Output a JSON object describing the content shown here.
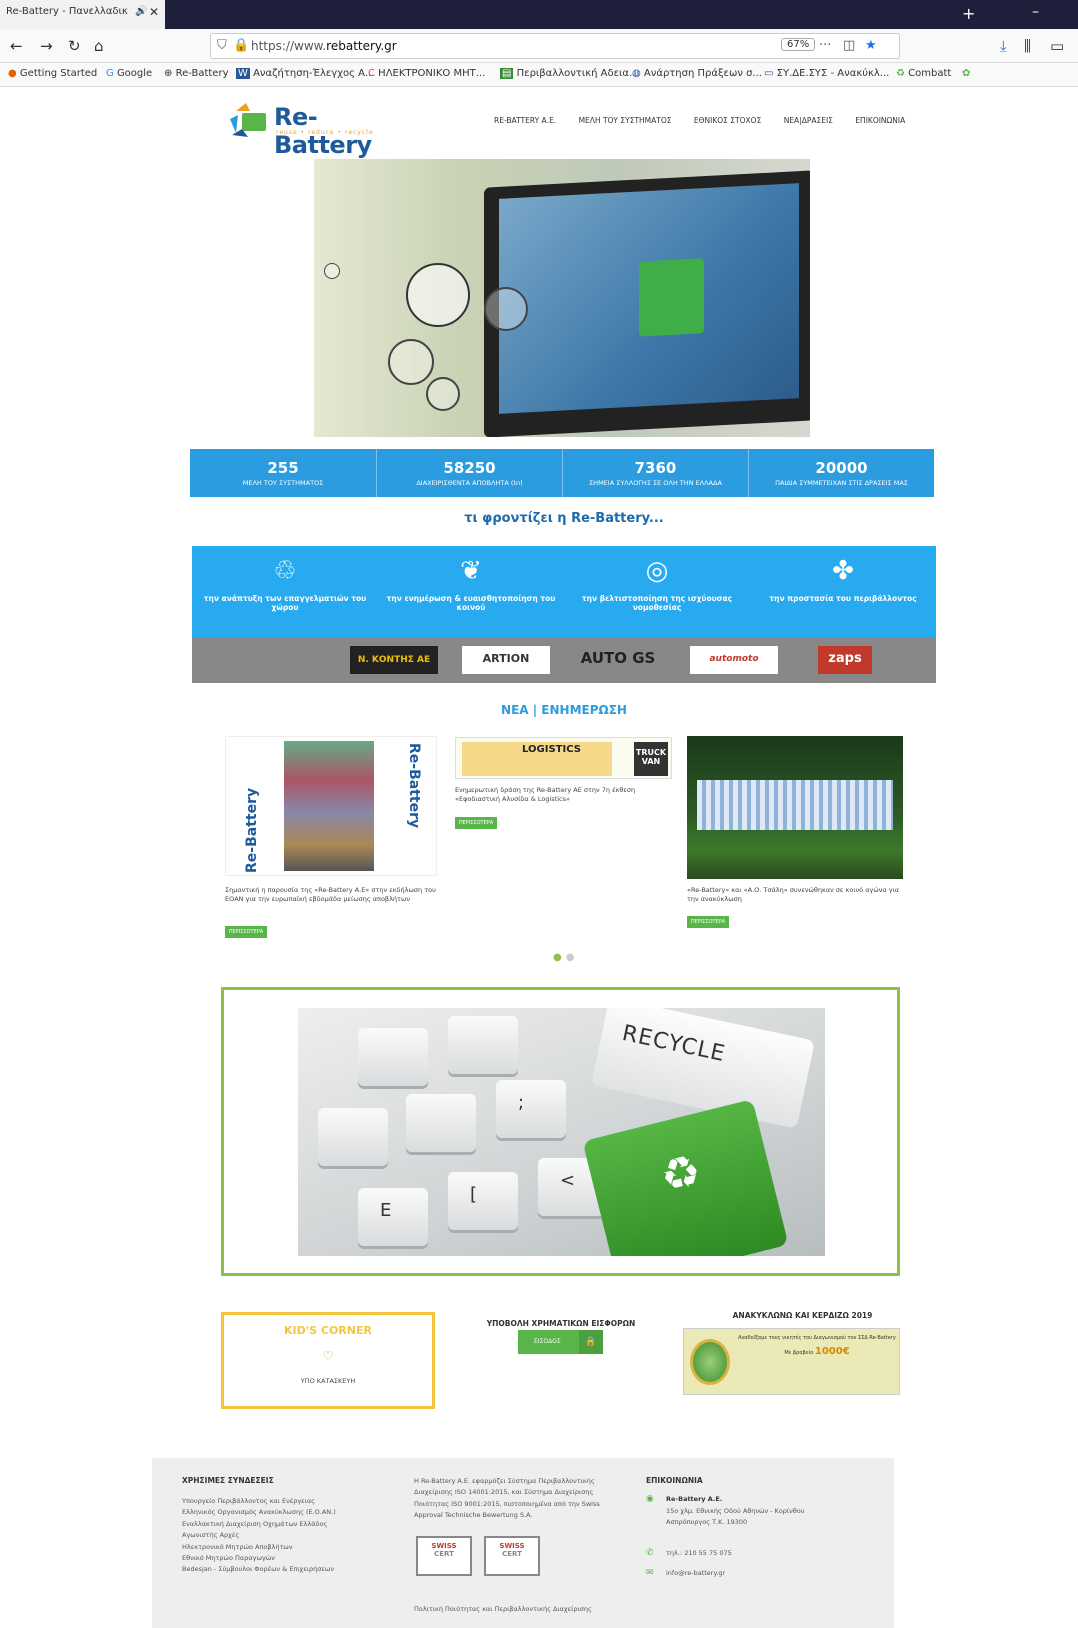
{
  "browser": {
    "tab_title": "Re-Battery - Πανελλαδικ",
    "url_protocol": "https://www.",
    "url_domain": "rebattery.gr",
    "zoom": "67%",
    "bookmarks": [
      "Getting Started",
      "Google",
      "Re-Battery",
      "Αναζήτηση-Έλεγχος Α...",
      "ΗΛΕΚΤΡΟΝΙΚΟ ΜΗΤ...",
      "Περιβαλλοντική Αδεια...",
      "Ανάρτηση Πράξεων σ...",
      "ΣΥ.ΔΕ.ΣΥΣ - Ανακύκλ...",
      "Combatt"
    ]
  },
  "site": {
    "logo_name": "Re-Battery",
    "logo_tagline": "reuse • reduce • recycle",
    "nav": [
      "RE-BATTERY Α.Ε.",
      "ΜΕΛΗ ΤΟΥ ΣΥΣΤΗΜΑΤΟΣ",
      "ΕΘΝΙΚΟΣ ΣΤΟΧΟΣ",
      "ΝΕΑ|ΔΡΑΣΕΙΣ",
      "ΕΠΙΚΟΙΝΩΝΙΑ"
    ]
  },
  "stats": [
    {
      "value": "255",
      "label": "ΜΕΛΗ ΤΟΥ ΣΥΣΤΗΜΑΤΟΣ"
    },
    {
      "value": "58250",
      "label": "ΔΙΑΧΕΙΡΙΣΘΕΝΤΑ ΑΠΟΒΛΗΤΑ (tn)"
    },
    {
      "value": "7360",
      "label": "ΣΗΜΕΙΑ ΣΥΛΛΟΓΗΣ ΣΕ ΟΛΗ ΤΗΝ ΕΛΛΑΔΑ"
    },
    {
      "value": "20000",
      "label": "ΠΑΙΔΙΑ ΣΥΜΜΕΤΕΙΧΑΝ ΣΤΙΣ ΔΡΑΣΕΙΣ ΜΑΣ"
    }
  ],
  "care": {
    "title": "τι φροντίζει η Re-Battery...",
    "items": [
      {
        "icon": "battery-care-icon",
        "text": "την ανάπτυξη των επαγγελματιών του χώρου"
      },
      {
        "icon": "hands-leaf-icon",
        "text": "την ενημέρωση & ευαισθητοποίηση του κοινού"
      },
      {
        "icon": "globe-hand-icon",
        "text": "την βελτιστοποίηση της ισχύουσας νομοθεσίας"
      },
      {
        "icon": "tree-icon",
        "text": "την προστασία του περιβάλλοντος"
      }
    ]
  },
  "partners": [
    "",
    "Ν. ΚΟΝΤΗΣ ΑΕ",
    "ARTION",
    "AUTO GS",
    "automoto",
    "zaps"
  ],
  "news": {
    "title": "ΝΕΑ | ΕΝΗΜΕΡΩΣΗ",
    "items": [
      {
        "caption": "Σημαντική η παρουσία της «Re-Battery Α.Ε» στην εκδήλωση του ΕΟΑΝ για την ευρωπαϊκή εβδομάδα μείωσης αποβλήτων",
        "more": "ΠΕΡΙΣΣΟΤΕΡΑ"
      },
      {
        "caption": "Ενημερωτική δράση της Re-Battery AE στην 7η έκθεση «Εφοδιαστική Αλυσίδα & Logistics»",
        "more": "ΠΕΡΙΣΣΟΤΕΡΑ"
      },
      {
        "caption": "«Re-Battery» και «Α.Ο. Τσάλη» συνενώθηκαν σε κοινό αγώνα για την ανακύκλωση",
        "more": "ΠΕΡΙΣΣΟΤΕΡΑ"
      }
    ],
    "img1_side_text": "Re-Battery",
    "img2_headline": "LOGISTICS",
    "img2_sub": "TRUCK VAN"
  },
  "recycle_key": "RECYCLE",
  "kids": {
    "title": "KID'S CORNER",
    "status": "ΥΠΟ ΚΑΤΑΣΚΕΥΗ"
  },
  "contrib": {
    "title": "ΥΠΟΒΟΛΗ ΧΡΗΜΑΤΙΚΩΝ ΕΙΣΦΟΡΩΝ",
    "button": "ΕΙΣΟΔΟΣ"
  },
  "recwin": {
    "title": "ΑΝΑΚΥΚΛΩΝΩ ΚΑΙ ΚΕΡΔΙΖΩ 2019",
    "line1": "Αναδείξαμε τους νικητές του Διαγωνισμού του ΣΣΔ Re-Battery",
    "amount": "1000€",
    "line2": "Με βραβείο"
  },
  "footer": {
    "links_title": "ΧΡΗΣΙΜΕΣ ΣΥΝΔΕΣΕΙΣ",
    "links": [
      "Υπουργείο Περιβάλλοντος και Ενέργειας",
      "Ελληνικός Οργανισμός Ανακύκλωσης (Ε.Ο.ΑΝ.)",
      "Εναλλακτική Διαχείριση Οχημάτων Ελλάδος",
      "Αγωνιστής Αρχές",
      "Ηλεκτρονικό Μητρώο Αποβλήτων",
      "Εθνικό Μητρώο Παραγωγών",
      "Bedesjan - Σύμβουλοι Φορέων & Επιχειρήσεων"
    ],
    "about": "Η Re-Battery Α.Ε. εφαρμόζει Σύστημα Περιβαλλοντικής Διαχείρισης ISO 14001:2015, και Σύστημα Διαχείρισης Ποιότητας ISO 9001:2015, πιστοποιημένα από την Swiss Approval Technische Bewertung S.A.",
    "cert": "SWISS",
    "cert_sub": "CERT",
    "policy": "Πολιτική Ποιότητας και Περιβαλλοντικής Διαχείρισης",
    "contact_title": "ΕΠΙΚΟΙΝΩΝΙΑ",
    "company": "Re-Battery A.E.",
    "address": "15ο χλμ. Εθνικής Οδού Αθηνών - Κορίνθου Ασπρόπυργος Τ.Κ. 19300",
    "phone": "τηλ.: 210 55 75 075",
    "email": "info@re-battery.gr"
  }
}
